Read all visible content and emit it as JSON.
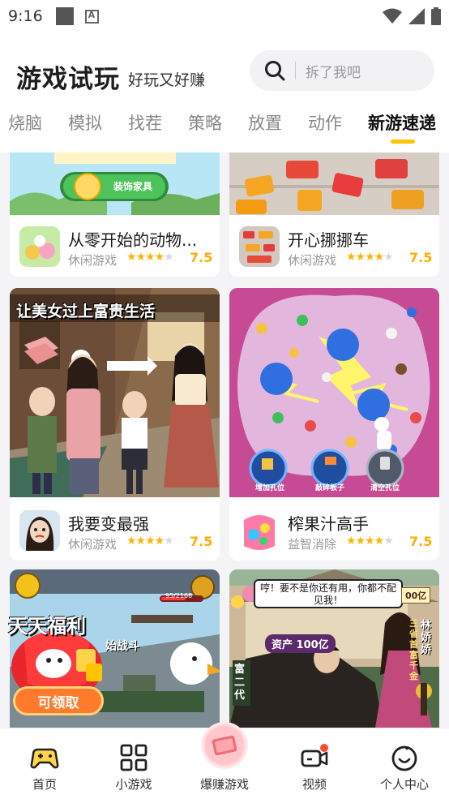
{
  "status_bar": {
    "time": "9:16"
  },
  "header": {
    "title": "游戏试玩",
    "subtitle": "好玩又好赚",
    "search_placeholder": "拆了我吧"
  },
  "tabs": [
    "烧脑",
    "模拟",
    "找茬",
    "策略",
    "放置",
    "动作",
    "新游速递"
  ],
  "games": [
    {
      "name": "从零开始的动物...",
      "category": "休闲游戏",
      "rating": "7.5",
      "stars": 3.5,
      "art_text": "装饰家具"
    },
    {
      "name": "开心挪挪车",
      "category": "休闲游戏",
      "rating": "7.5",
      "stars": 3.5
    },
    {
      "name": "我要变最强",
      "category": "休闲游戏",
      "rating": "7.5",
      "stars": 3.5,
      "art_text": "让美女过上富贵生活"
    },
    {
      "name": "榨果汁高手",
      "category": "益智消除",
      "rating": "7.5",
      "stars": 3.5,
      "art_labels": [
        "增加孔位",
        "敲碎板子",
        "清空孔位"
      ]
    },
    {
      "name": "",
      "category": "",
      "rating": "",
      "art_text": "始战斗",
      "art_stat": "95/2168"
    },
    {
      "name": "",
      "category": "",
      "rating": "",
      "art_text": "哼！要不是你还有用，你都不配见我！",
      "art_labels": [
        "资产 100亿",
        "富二代",
        "林娇娇",
        "三省首富千金",
        "00亿"
      ]
    }
  ],
  "promo": {
    "title": "天天福利",
    "button": "可领取"
  },
  "bottom_nav": [
    {
      "label": "首页",
      "icon": "gamepad-icon"
    },
    {
      "label": "小游戏",
      "icon": "grid-icon"
    },
    {
      "label": "爆赚游戏",
      "icon": "cash-icon"
    },
    {
      "label": "视频",
      "icon": "video-icon"
    },
    {
      "label": "个人中心",
      "icon": "smile-icon"
    }
  ],
  "colors": {
    "accent": "#ffc400",
    "rating": "#ffae00",
    "promo_red": "#e8262c"
  }
}
